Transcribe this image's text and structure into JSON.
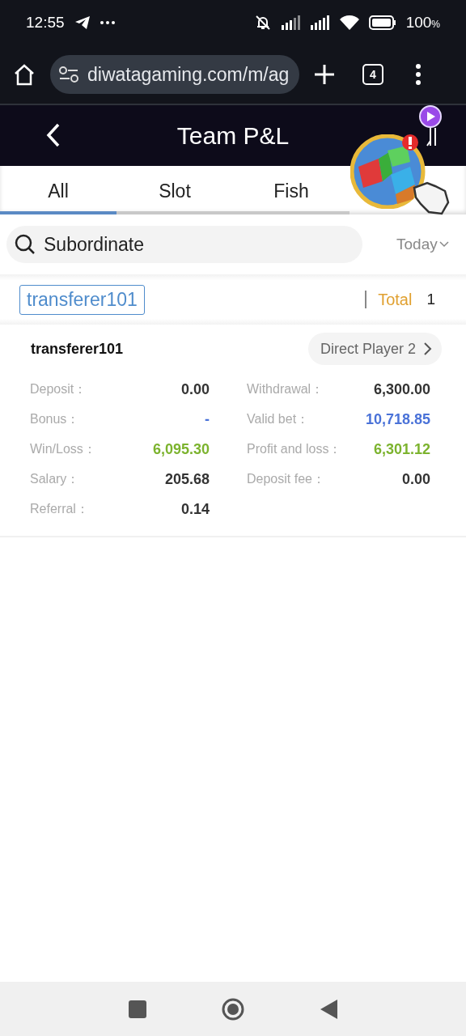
{
  "status_bar": {
    "time": "12:55",
    "battery": "100",
    "battery_unit": "%"
  },
  "browser": {
    "url": "diwatagaming.com/m/ag",
    "tab_count": "4"
  },
  "header": {
    "title": "Team P&L"
  },
  "tabs": [
    {
      "label": "All",
      "selected": true
    },
    {
      "label": "Slot",
      "selected": false
    },
    {
      "label": "Fish",
      "selected": false
    }
  ],
  "search": {
    "value": "Subordinate"
  },
  "date_filter": "Today",
  "agent": {
    "name": "transferer101",
    "total_label": "Total",
    "total": "1"
  },
  "member": {
    "name": "transferer101",
    "link": "Direct Player 2"
  },
  "stats": [
    {
      "label": "Deposit：",
      "value": "0.00",
      "kind": "normal"
    },
    {
      "label": "Withdrawal：",
      "value": "6,300.00",
      "kind": "normal"
    },
    {
      "label": "Bonus：",
      "value": "-",
      "kind": "link"
    },
    {
      "label": "Valid bet：",
      "value": "10,718.85",
      "kind": "link"
    },
    {
      "label": "Win/Loss：",
      "value": "6,095.30",
      "kind": "positive"
    },
    {
      "label": "Profit and loss：",
      "value": "6,301.12",
      "kind": "positive"
    },
    {
      "label": "Salary：",
      "value": "205.68",
      "kind": "normal"
    },
    {
      "label": "Deposit fee：",
      "value": "0.00",
      "kind": "normal"
    },
    {
      "label": "Referral：",
      "value": "0.14",
      "kind": "normal"
    }
  ]
}
